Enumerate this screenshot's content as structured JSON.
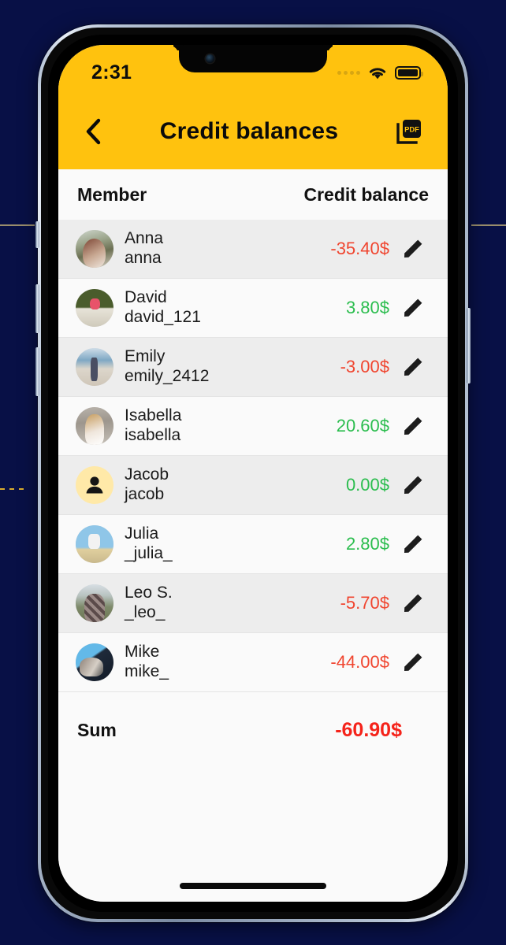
{
  "colors": {
    "accent_yellow": "#FFC20E",
    "negative": "#F0452F",
    "positive": "#2BBD4E",
    "sum_negative": "#F5231A",
    "backdrop": "#081046",
    "row_alt": "#EDEDED",
    "row_base": "#FAFAFA"
  },
  "status_bar": {
    "time": "2:31",
    "signal_icon": "signal-dots-icon",
    "wifi_icon": "wifi-icon",
    "battery_icon": "battery-full-icon"
  },
  "app_bar": {
    "back_icon": "chevron-left-icon",
    "title": "Credit balances",
    "pdf_icon": "pdf-export-icon",
    "pdf_label": "PDF"
  },
  "table": {
    "columns": {
      "member": "Member",
      "balance": "Credit balance"
    },
    "rows": [
      {
        "name": "Anna",
        "handle": "anna",
        "amount": "-35.40$",
        "sign": "neg",
        "avatar": "photo",
        "avatar_class": "ph-anna",
        "edit_icon": "pencil-icon"
      },
      {
        "name": "David",
        "handle": "david_121",
        "amount": "3.80$",
        "sign": "pos",
        "avatar": "photo",
        "avatar_class": "ph-david",
        "edit_icon": "pencil-icon"
      },
      {
        "name": "Emily",
        "handle": "emily_2412",
        "amount": "-3.00$",
        "sign": "neg",
        "avatar": "photo",
        "avatar_class": "ph-emily",
        "edit_icon": "pencil-icon"
      },
      {
        "name": "Isabella",
        "handle": "isabella",
        "amount": "20.60$",
        "sign": "pos",
        "avatar": "photo",
        "avatar_class": "ph-isabella",
        "edit_icon": "pencil-icon"
      },
      {
        "name": "Jacob",
        "handle": "jacob",
        "amount": "0.00$",
        "sign": "pos",
        "avatar": "placeholder",
        "avatar_class": "",
        "edit_icon": "pencil-icon"
      },
      {
        "name": "Julia",
        "handle": "_julia_",
        "amount": "2.80$",
        "sign": "pos",
        "avatar": "photo",
        "avatar_class": "ph-julia",
        "edit_icon": "pencil-icon"
      },
      {
        "name": "Leo S.",
        "handle": "_leo_",
        "amount": "-5.70$",
        "sign": "neg",
        "avatar": "photo",
        "avatar_class": "ph-leo",
        "edit_icon": "pencil-icon"
      },
      {
        "name": "Mike",
        "handle": "mike_",
        "amount": "-44.00$",
        "sign": "neg",
        "avatar": "photo",
        "avatar_class": "ph-mike",
        "edit_icon": "pencil-icon"
      }
    ],
    "summary": {
      "label": "Sum",
      "value": "-60.90$",
      "sign": "neg"
    }
  },
  "device": {
    "home_indicator": "home-indicator",
    "camera": "front-camera-icon"
  }
}
